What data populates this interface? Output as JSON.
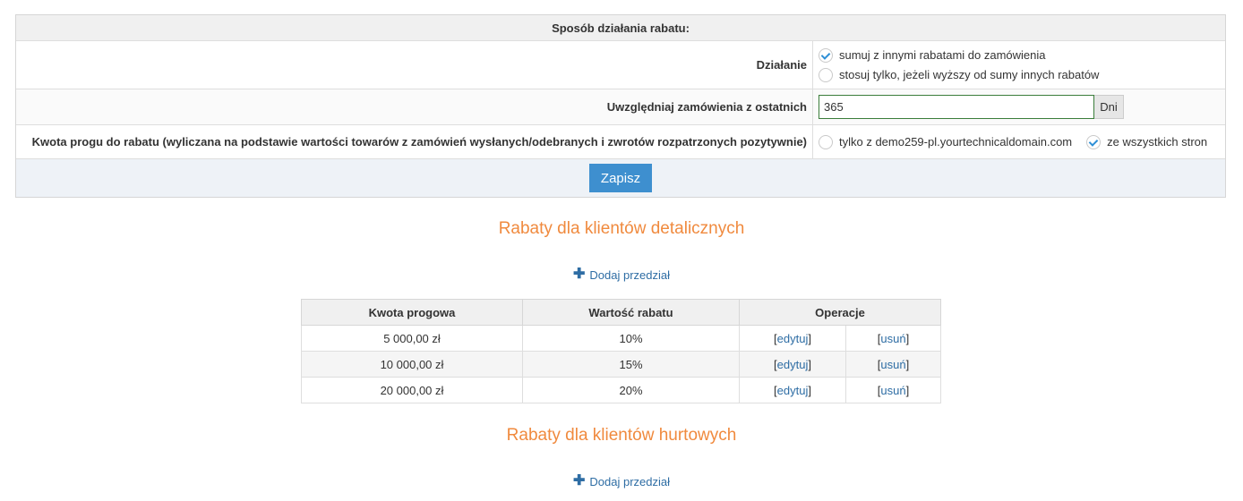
{
  "settings": {
    "header": "Sposób działania rabatu:",
    "dzialanie": {
      "label": "Działanie",
      "options": [
        {
          "label": "sumuj z innymi rabatami do zamówienia",
          "checked": true
        },
        {
          "label": "stosuj tylko, jeżeli wyższy od sumy innych rabatów",
          "checked": false
        }
      ]
    },
    "ostatnich": {
      "label": "Uwzględniaj zamówienia z ostatnich",
      "value": "365",
      "unit": "Dni"
    },
    "prog": {
      "label": "Kwota progu do rabatu (wyliczana na podstawie wartości towarów z zamówień wysłanych/odebranych i zwrotów rozpatrzonych pozytywnie)",
      "options": [
        {
          "label": "tylko z demo259-pl.yourtechnicaldomain.com",
          "checked": false
        },
        {
          "label": "ze wszystkich stron",
          "checked": true
        }
      ]
    },
    "save_label": "Zapisz"
  },
  "retail": {
    "title": "Rabaty dla klientów detalicznych",
    "add_label": "Dodaj przedział",
    "columns": [
      "Kwota progowa",
      "Wartość rabatu",
      "Operacje"
    ],
    "rows": [
      {
        "kwota": "5 000,00 zł",
        "wartosc": "10%",
        "edit": "edytuj",
        "delete": "usuń"
      },
      {
        "kwota": "10 000,00 zł",
        "wartosc": "15%",
        "edit": "edytuj",
        "delete": "usuń"
      },
      {
        "kwota": "20 000,00 zł",
        "wartosc": "20%",
        "edit": "edytuj",
        "delete": "usuń"
      }
    ]
  },
  "wholesale": {
    "title": "Rabaty dla klientów hurtowych",
    "add_label": "Dodaj przedział"
  },
  "colors": {
    "accent": "#f08a3e",
    "link": "#2e6da4",
    "button": "#3e8fcf"
  }
}
